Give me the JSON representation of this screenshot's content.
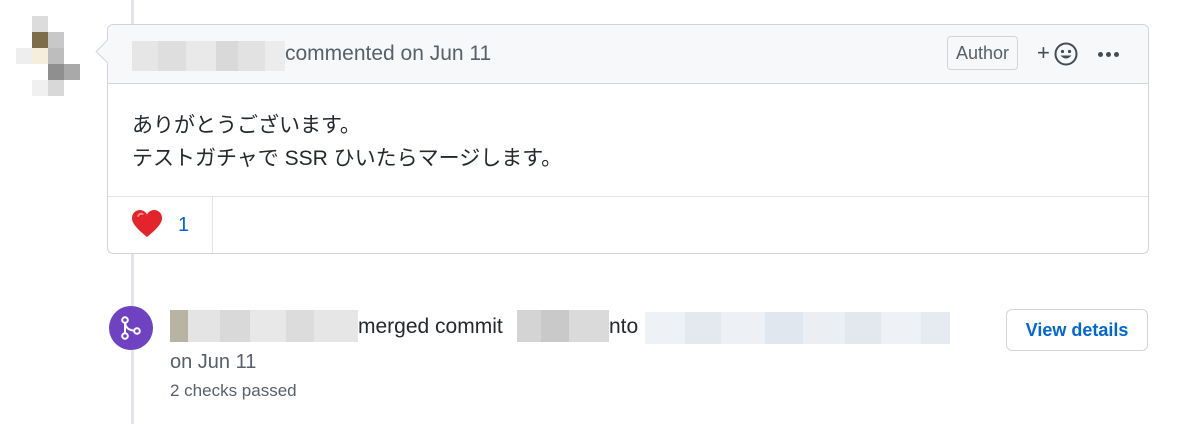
{
  "comment": {
    "header_action": "commented on Jun 11",
    "author_badge": "Author",
    "add_reaction_label": "+",
    "body_lines": [
      "ありがとうございます。",
      "テストガチャで SSR ひいたらマージします。"
    ],
    "reaction": {
      "emoji": "❤️",
      "count": "1"
    }
  },
  "merge_event": {
    "action": "merged commit",
    "into": "nto",
    "date": "on Jun 11",
    "checks": "2 checks passed",
    "view_details": "View details"
  },
  "icons": {
    "reaction": "smiley-icon",
    "more": "kebab-icon",
    "merge": "git-merge-icon",
    "heart": "heart-icon"
  },
  "colors": {
    "link": "#0366d6",
    "merge_badge": "#6f42c1",
    "heart": "#e3242b",
    "border": "#d1d5da",
    "header_bg": "#f6f8fa"
  }
}
